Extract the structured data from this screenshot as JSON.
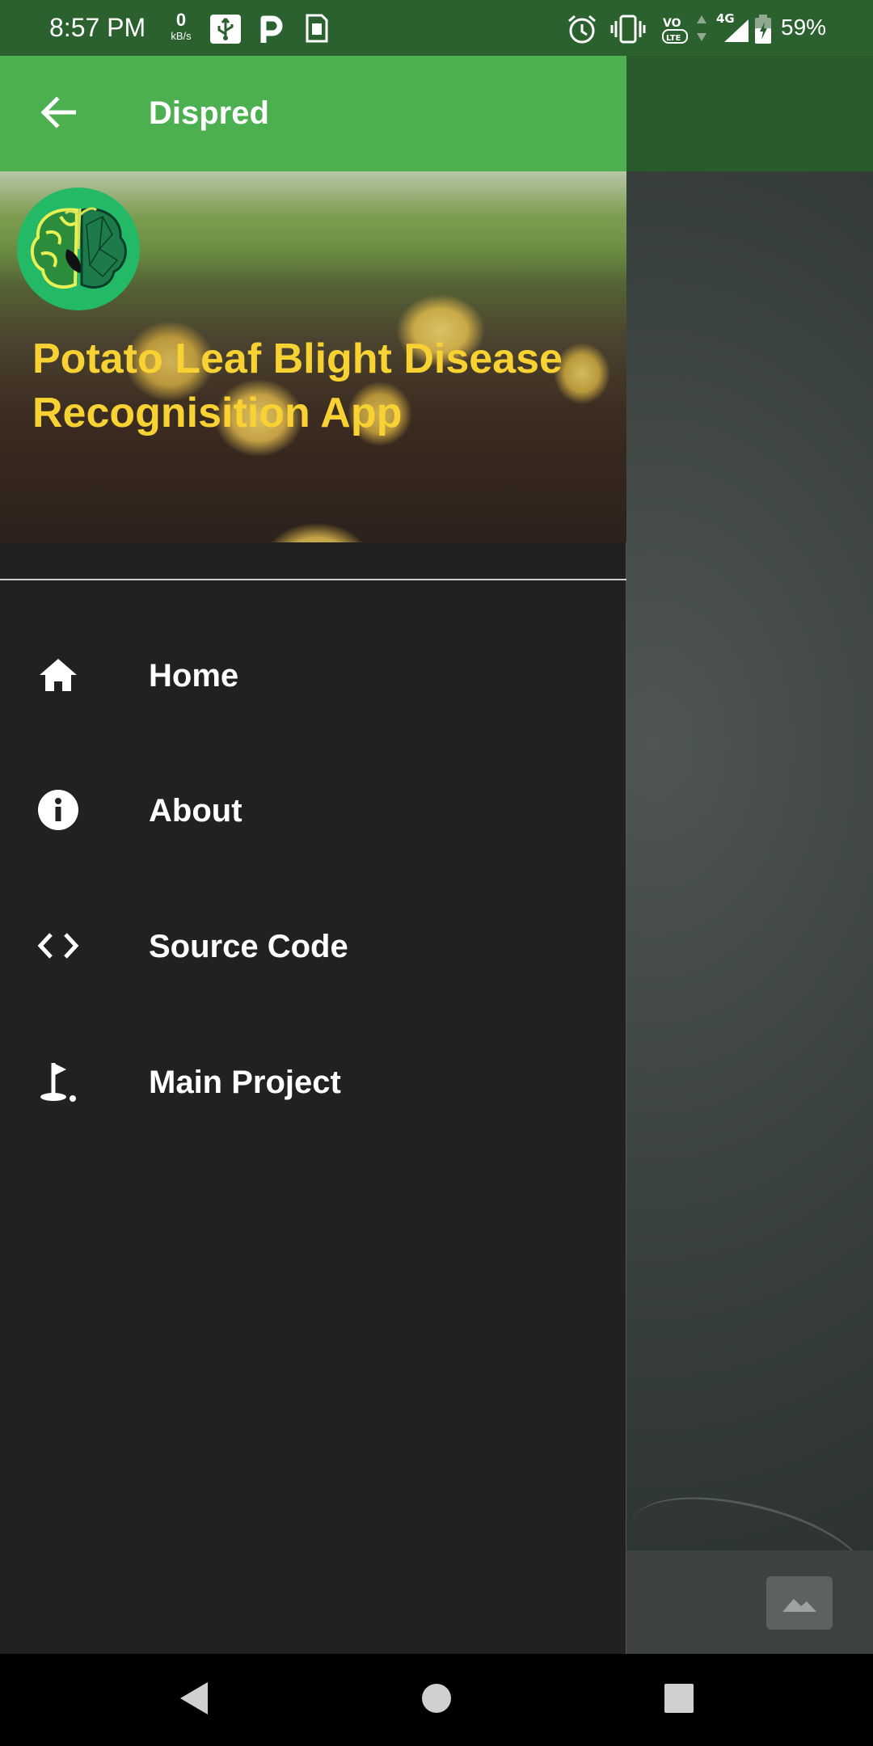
{
  "status_bar": {
    "time": "8:57 PM",
    "net_speed_value": "0",
    "net_speed_unit": "kB/s",
    "battery": "59%",
    "icons": [
      "usb-icon",
      "parking-icon",
      "sim-card-icon",
      "alarm-icon",
      "vibrate-icon",
      "volte-icon",
      "data-arrows-icon",
      "signal-4g-icon",
      "battery-charging-icon"
    ]
  },
  "drawer": {
    "title": "Dispred",
    "back_icon": "arrow-back-icon",
    "header": {
      "logo": "brain-leaf-logo",
      "title": "Potato Leaf Blight Disease Recognisition App"
    },
    "items": [
      {
        "label": "Home",
        "icon": "home-icon"
      },
      {
        "label": "About",
        "icon": "info-icon"
      },
      {
        "label": "Source Code",
        "icon": "code-icon"
      },
      {
        "label": "Main Project",
        "icon": "golf-flag-icon"
      }
    ]
  },
  "background": {
    "image_button_icon": "image-icon"
  },
  "nav_bar": {
    "buttons": [
      "back-triangle-icon",
      "home-circle-icon",
      "recents-square-icon"
    ]
  },
  "colors": {
    "app_bar": "#4caf50",
    "status_bar": "#2b612e",
    "drawer_bg": "#212121",
    "header_title": "#f6d13a",
    "logo_bg": "#28b768"
  }
}
